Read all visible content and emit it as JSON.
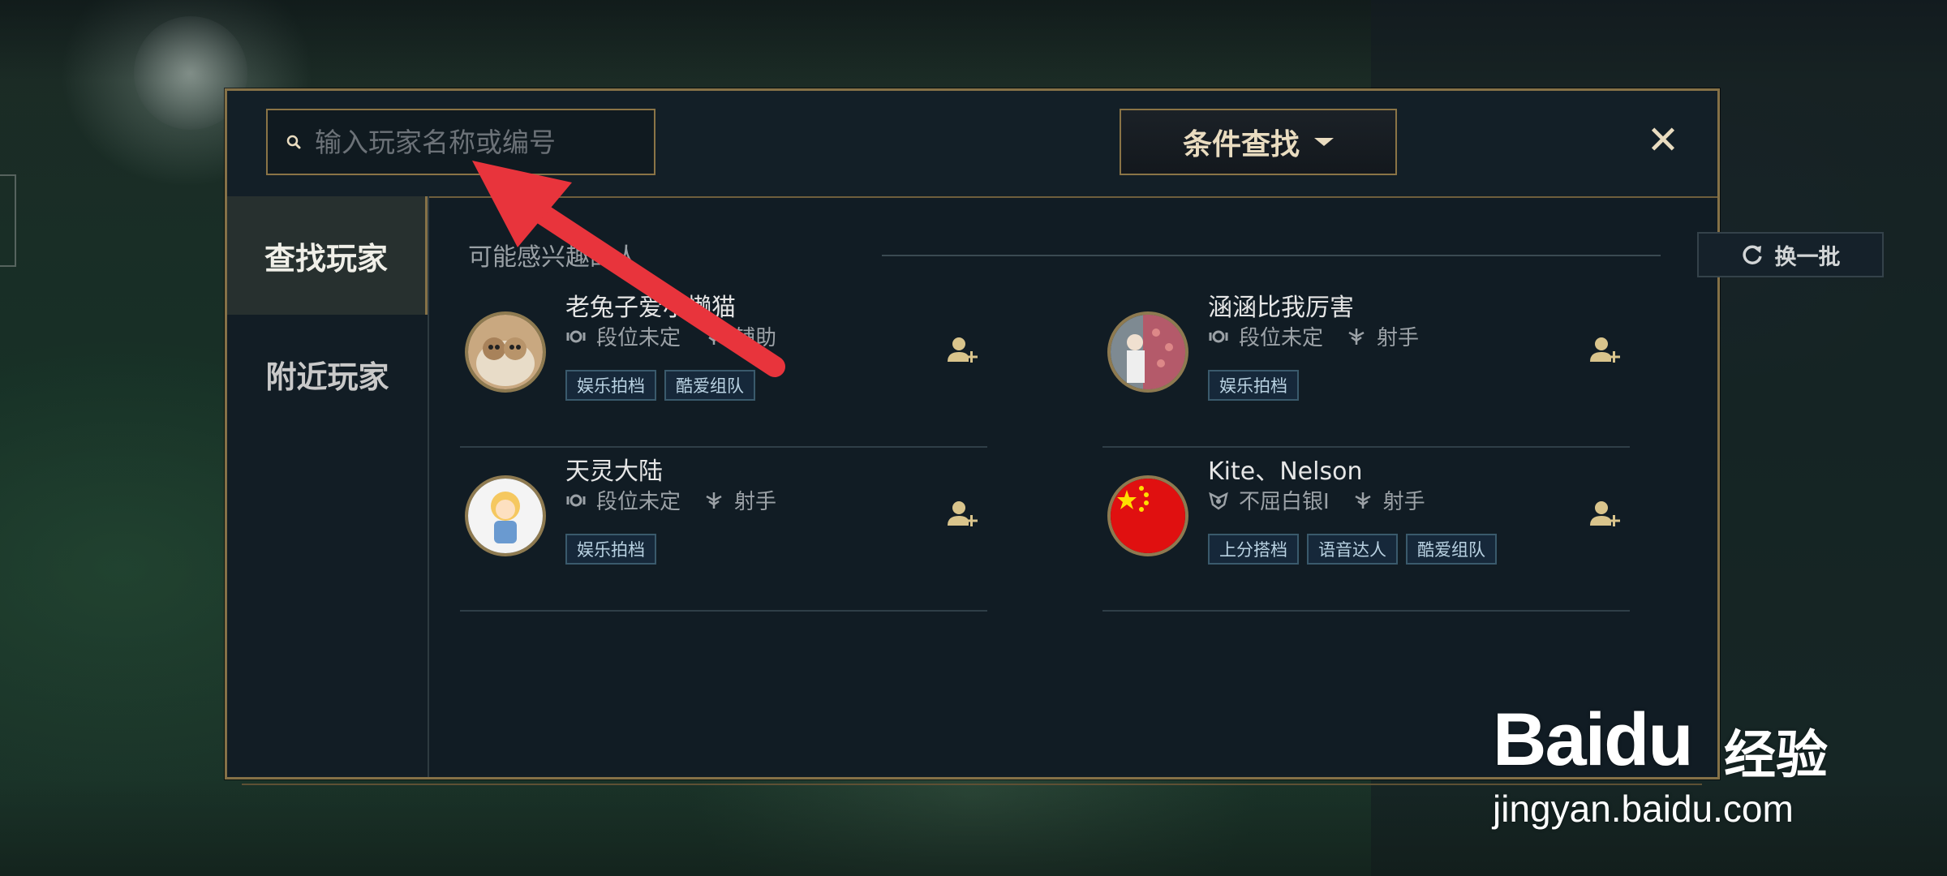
{
  "dialog": {
    "search": {
      "placeholder": "输入玩家名称或编号",
      "value": ""
    },
    "condition_button": "条件查找",
    "close_icon": "close-icon"
  },
  "nav": {
    "items": [
      {
        "label": "查找玩家",
        "active": true
      },
      {
        "label": "附近玩家",
        "active": false
      }
    ]
  },
  "content": {
    "section_title": "可能感兴趣的人",
    "refresh_label": "换一批",
    "players": [
      {
        "name": "老兔子爱小懒猫",
        "rank": "段位未定",
        "role": "辅助",
        "tags": [
          "娱乐拍档",
          "酷爱组队"
        ],
        "avatar": "cat-avatar"
      },
      {
        "name": "涵涵比我厉害",
        "rank": "段位未定",
        "role": "射手",
        "tags": [
          "娱乐拍档"
        ],
        "avatar": "photo-avatar"
      },
      {
        "name": "天灵大陆",
        "rank": "段位未定",
        "role": "射手",
        "tags": [
          "娱乐拍档"
        ],
        "avatar": "cartoon-avatar"
      },
      {
        "name": "Kite、Nelson",
        "rank": "不屈白银Ⅰ",
        "role": "射手",
        "tags": [
          "上分搭档",
          "语音达人",
          "酷爱组队"
        ],
        "avatar": "china-flag-avatar"
      }
    ]
  },
  "watermark": {
    "brand": "Baidu",
    "cn": "经验",
    "url": "jingyan.baidu.com"
  },
  "colors": {
    "gold_border": "#857147",
    "dialog_bg": "#111c24",
    "tag_border": "#3a5a6c",
    "annotation_arrow": "#e8343c"
  }
}
